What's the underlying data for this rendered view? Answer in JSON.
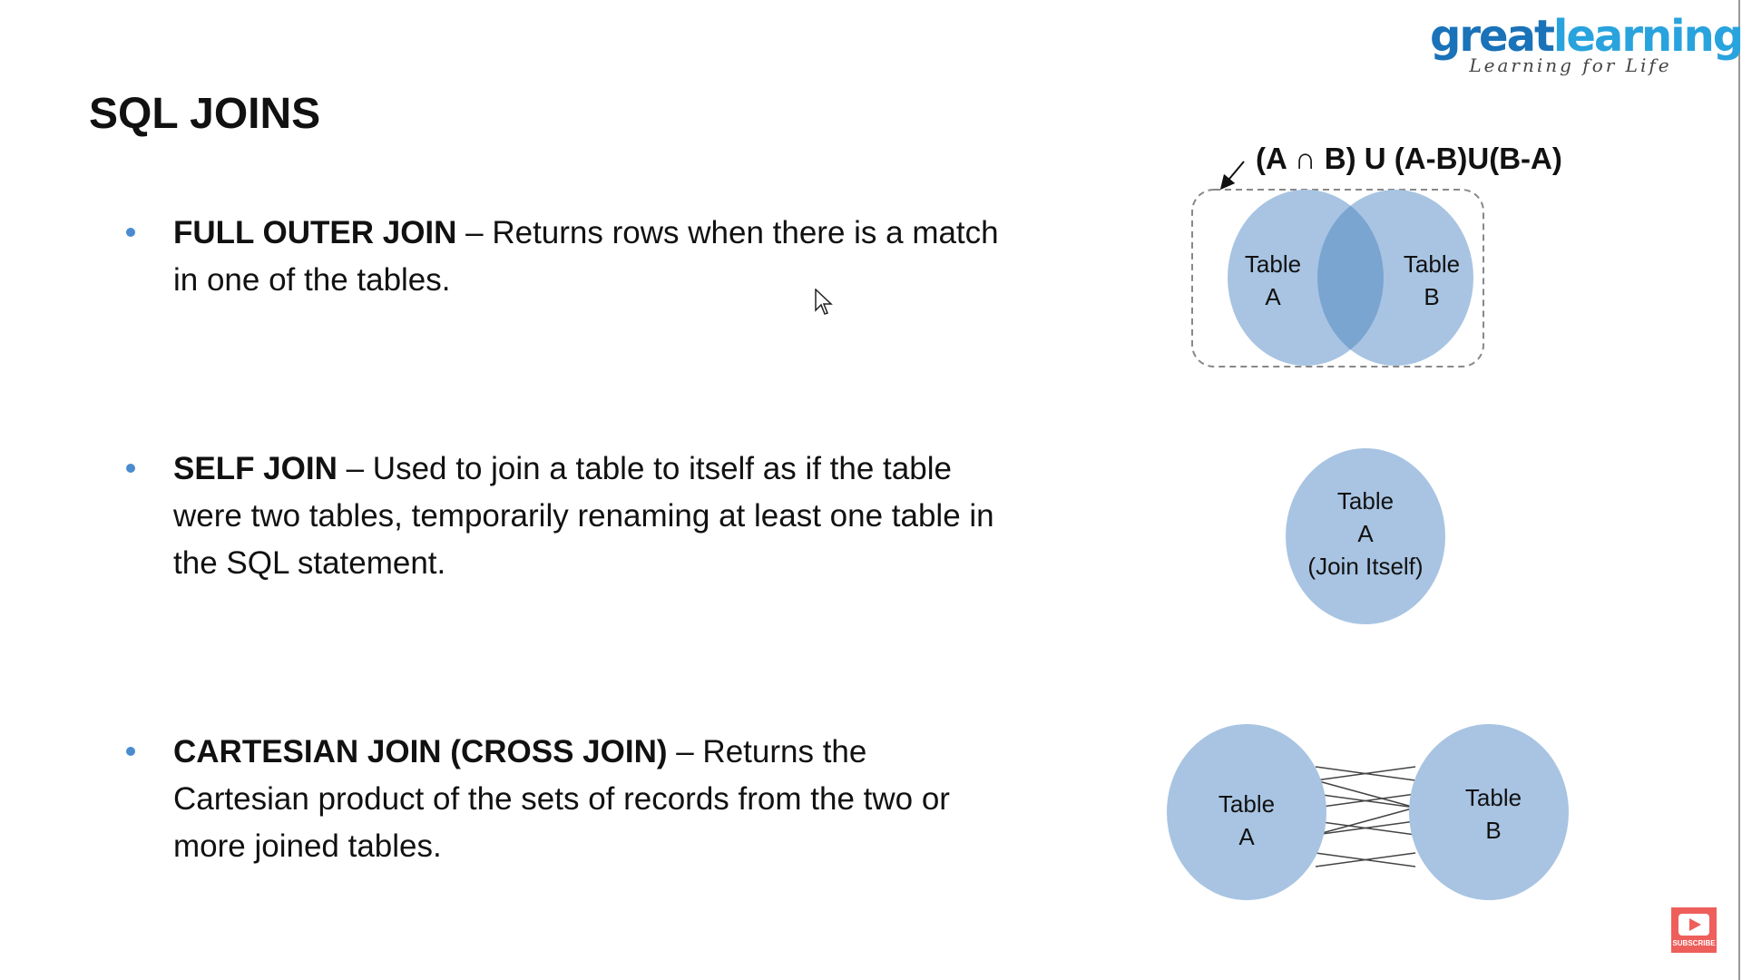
{
  "logo": {
    "word_part1": "great",
    "word_part2": "learning",
    "tagline": "Learning for Life"
  },
  "title": "SQL JOINS",
  "bullets": [
    {
      "term": "FULL OUTER JOIN",
      "desc": " – Returns rows when there is a match in one of the tables."
    },
    {
      "term": "SELF JOIN",
      "desc": " – Used to join a table to itself as if the table were two tables, temporarily renaming at least one table in the SQL statement."
    },
    {
      "term": "CARTESIAN JOIN (CROSS JOIN)",
      "desc": " – Returns the Cartesian product of the sets of records from the two or more joined tables."
    }
  ],
  "diagrams": {
    "full_outer": {
      "formula": "(A ∩ B) U (A-B)U(B-A)",
      "left": [
        "Table",
        "A"
      ],
      "right": [
        "Table",
        "B"
      ]
    },
    "self": {
      "lines": [
        "Table",
        "A",
        "(Join Itself)"
      ]
    },
    "cartesian": {
      "left": [
        "Table",
        "A"
      ],
      "right": [
        "Table",
        "B"
      ]
    }
  },
  "subscribe": {
    "label": "SUBSCRIBE"
  },
  "colors": {
    "circle": "#a8c4e2",
    "overlap": "#7aa5d0",
    "logo_dark": "#1a72b8",
    "logo_light": "#29a3dd",
    "subscribe": "#ee5f5b"
  }
}
